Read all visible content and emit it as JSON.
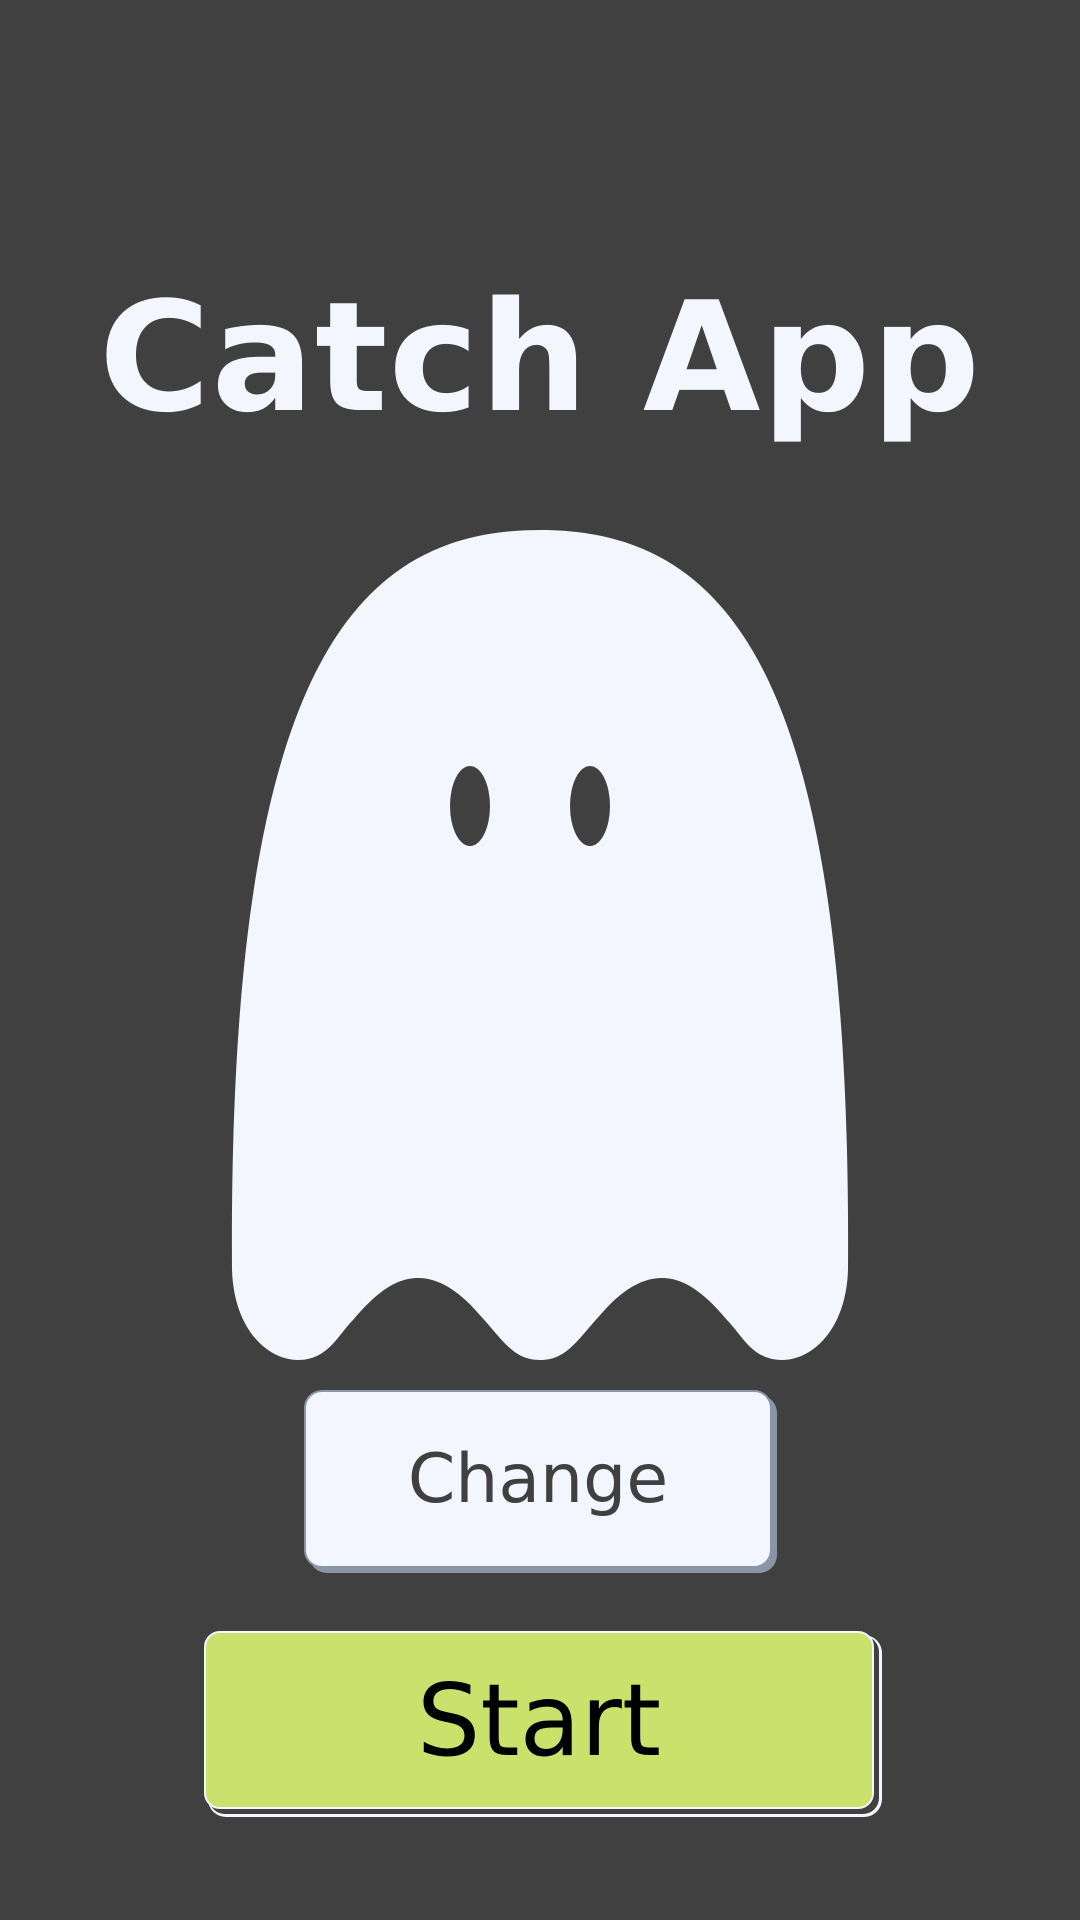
{
  "app": {
    "title": "Catch App"
  },
  "ghost": {
    "icon": "ghost-icon"
  },
  "buttons": {
    "change_label": "Change",
    "start_label": "Start"
  },
  "colors": {
    "background": "#404040",
    "ghost": "#f3f5ff",
    "start_button": "#cae26b",
    "change_button": "#f3f5ff",
    "change_text": "#404040",
    "start_text": "#000000"
  }
}
